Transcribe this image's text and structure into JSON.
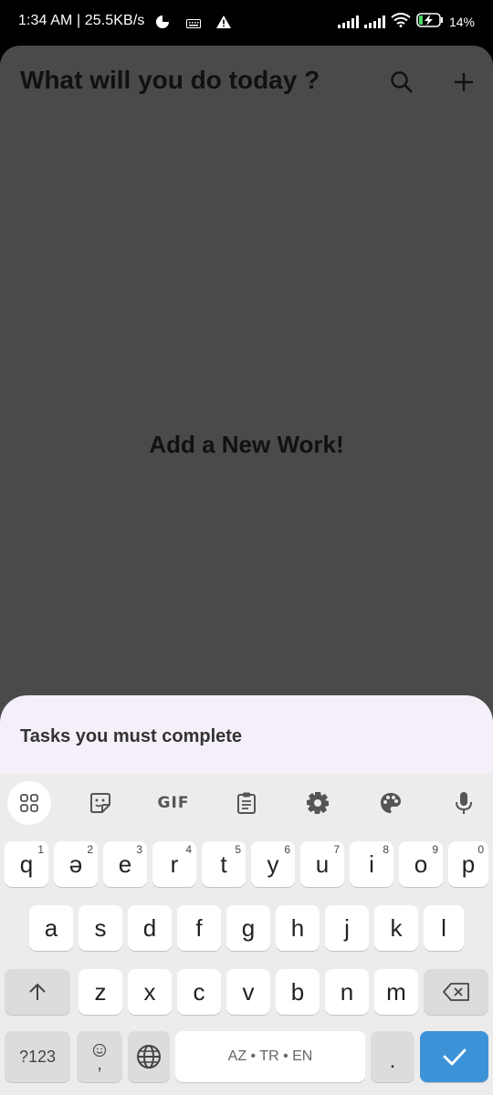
{
  "status_bar": {
    "time_net": "1:34 AM | 25.5KB/s",
    "battery": "14%"
  },
  "app": {
    "title": "What will you do today ?",
    "empty_text": "Add a New Work!"
  },
  "sheet": {
    "title": "Tasks you must complete"
  },
  "keyboard": {
    "toolbar": {
      "gif_label": "GIF"
    },
    "row1": [
      {
        "label": "q",
        "hint": "1"
      },
      {
        "label": "ə",
        "hint": "2"
      },
      {
        "label": "e",
        "hint": "3"
      },
      {
        "label": "r",
        "hint": "4"
      },
      {
        "label": "t",
        "hint": "5"
      },
      {
        "label": "y",
        "hint": "6"
      },
      {
        "label": "u",
        "hint": "7"
      },
      {
        "label": "i",
        "hint": "8"
      },
      {
        "label": "o",
        "hint": "9"
      },
      {
        "label": "p",
        "hint": "0"
      }
    ],
    "row2": [
      "a",
      "s",
      "d",
      "f",
      "g",
      "h",
      "j",
      "k",
      "l"
    ],
    "row3": [
      "z",
      "x",
      "c",
      "v",
      "b",
      "n",
      "m"
    ],
    "symbols_label": "?123",
    "comma_label": ",",
    "space_label": "AZ • TR • EN",
    "period_label": "."
  }
}
